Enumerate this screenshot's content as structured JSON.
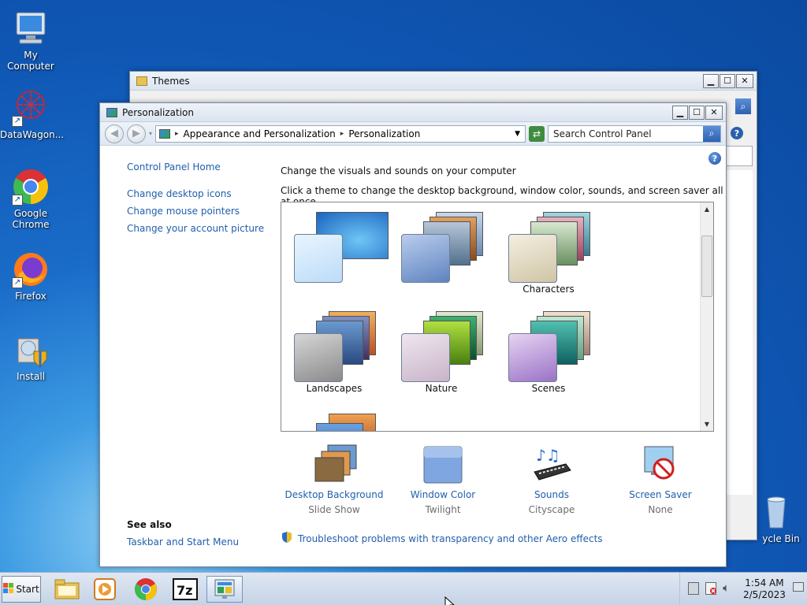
{
  "desktop": {
    "icons": [
      {
        "label": "My Computer"
      },
      {
        "label": "DataWagon..."
      },
      {
        "label": "Google Chrome"
      },
      {
        "label": "Firefox"
      },
      {
        "label": "Install"
      },
      {
        "label": "ycle Bin"
      }
    ]
  },
  "themes_window": {
    "title": "Themes"
  },
  "personalization": {
    "title": "Personalization",
    "breadcrumb": [
      "Appearance and Personalization",
      "Personalization"
    ],
    "search_placeholder": "Search Control Panel",
    "left_links": [
      "Control Panel Home",
      "Change desktop icons",
      "Change mouse pointers",
      "Change your account picture"
    ],
    "heading": "Change the visuals and sounds on your computer",
    "subheading": "Click a theme to change the desktop background, window color, sounds, and screen saver all at once.",
    "themes": [
      {
        "label": ""
      },
      {
        "label": ""
      },
      {
        "label": "Characters"
      },
      {
        "label": "Landscapes"
      },
      {
        "label": "Nature"
      },
      {
        "label": "Scenes"
      }
    ],
    "bottom_items": [
      {
        "name": "Desktop Background",
        "value": "Slide Show",
        "icon": "desktop-background-icon"
      },
      {
        "name": "Window Color",
        "value": "Twilight",
        "icon": "window-color-icon"
      },
      {
        "name": "Sounds",
        "value": "Cityscape",
        "icon": "sounds-icon"
      },
      {
        "name": "Screen Saver",
        "value": "None",
        "icon": "screen-saver-icon"
      }
    ],
    "see_also_title": "See also",
    "see_also_links": [
      "Taskbar and Start Menu"
    ],
    "troubleshoot": "Troubleshoot problems with transparency and other Aero effects"
  },
  "taskbar": {
    "start_label": "Start",
    "time": "1:54 AM",
    "date": "2/5/2023"
  }
}
